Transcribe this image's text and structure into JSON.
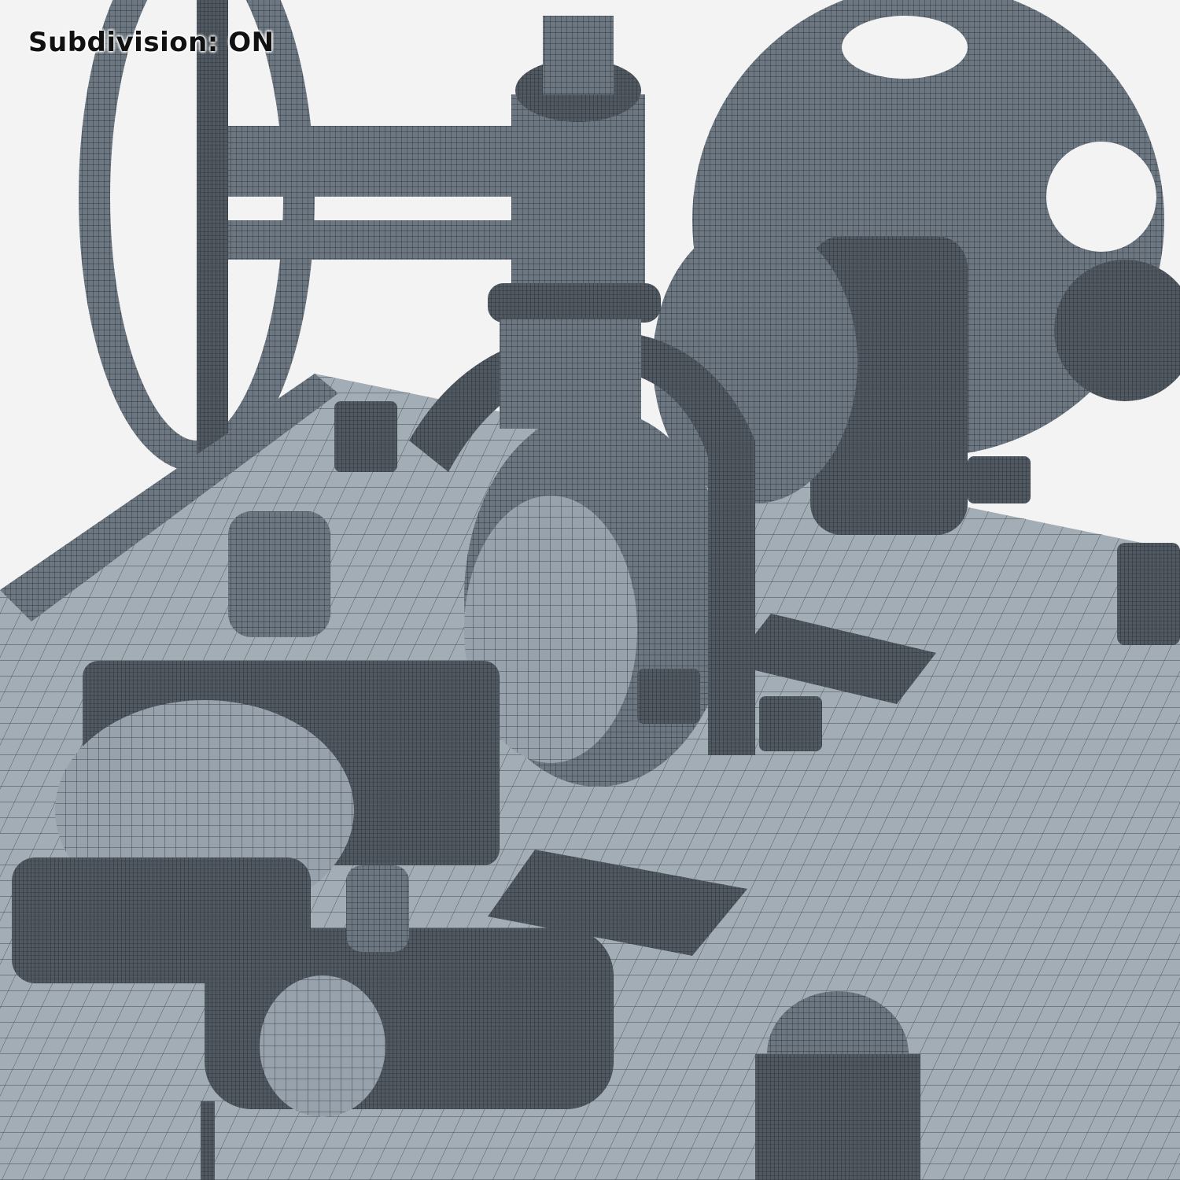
{
  "overlay": {
    "label": "Subdivision: ON"
  },
  "colors": {
    "background": "#f3f3f3",
    "mesh_light": "#8d98a3",
    "mesh_dark": "#4a525a",
    "wire": "#1e2328"
  }
}
